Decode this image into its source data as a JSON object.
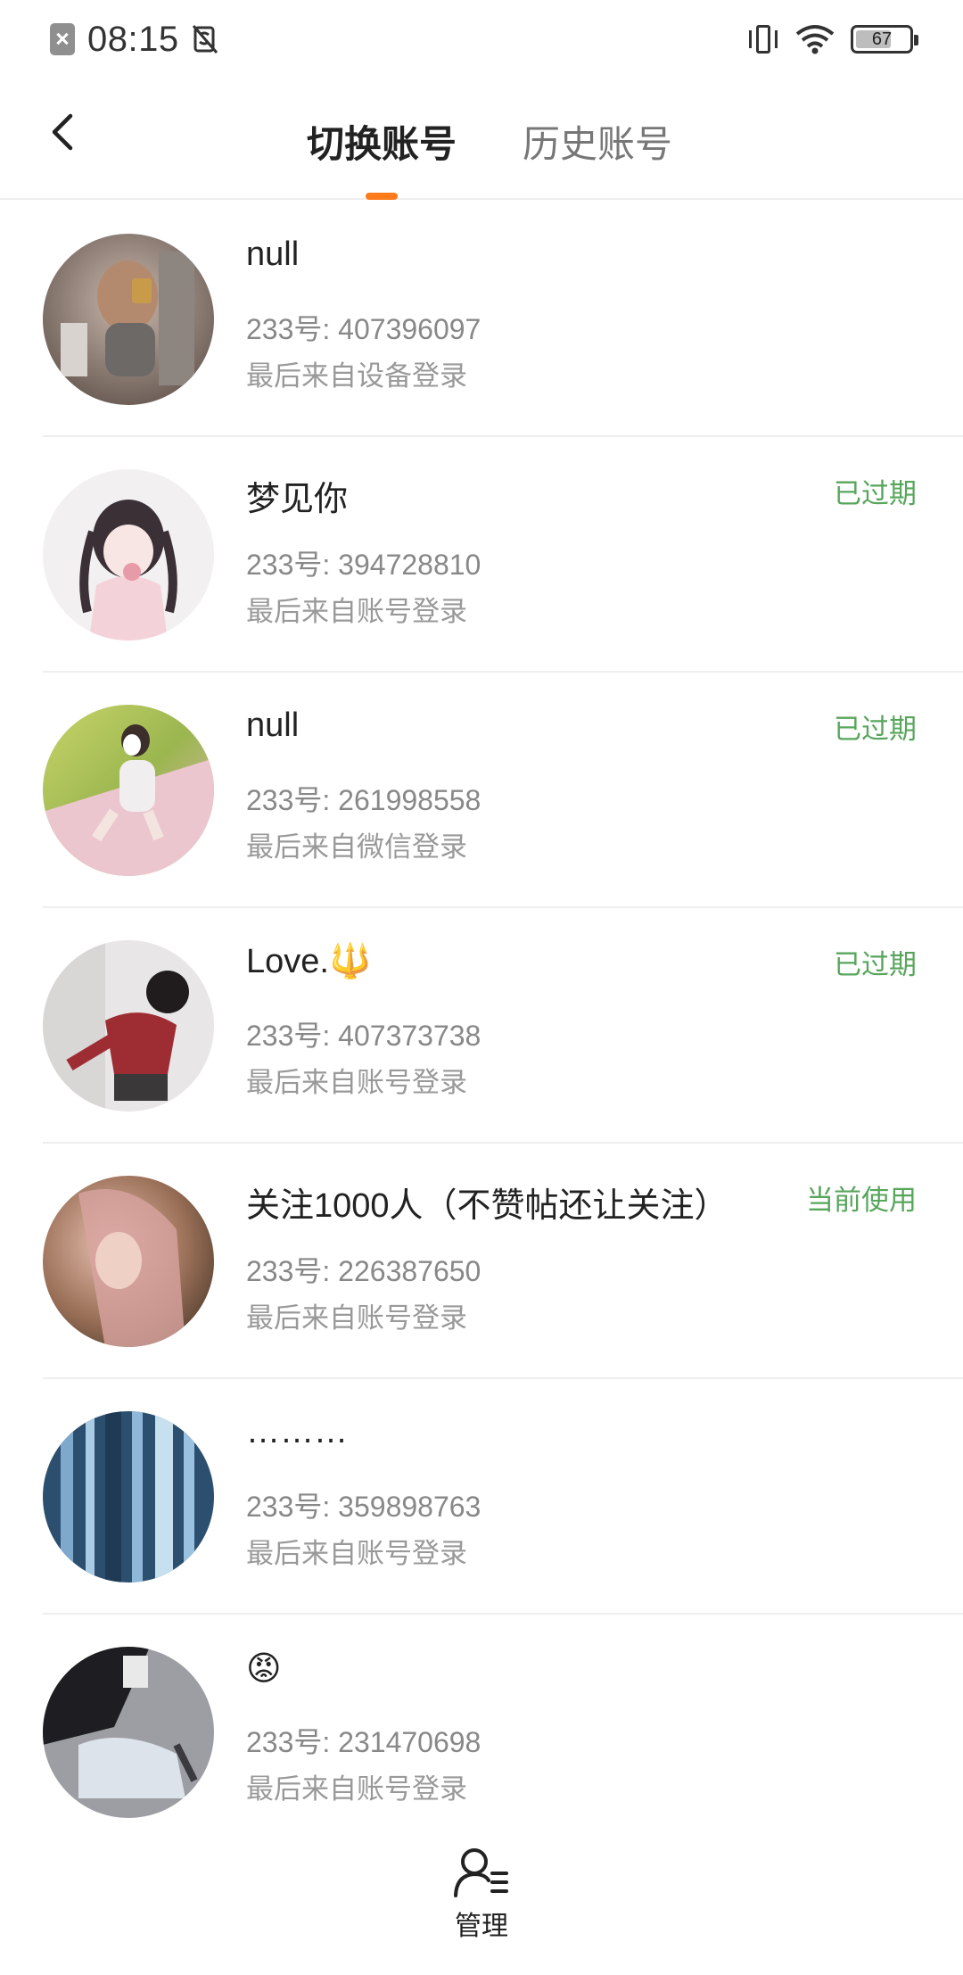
{
  "status_bar": {
    "time": "08:15",
    "battery": "67",
    "battery_level": 0.67
  },
  "header": {
    "tabs": [
      {
        "label": "切换账号",
        "active": true
      },
      {
        "label": "历史账号",
        "active": false
      }
    ],
    "accent_color": "#ff7a1a"
  },
  "accounts": [
    {
      "name": "null",
      "uid": "233号: 407396097",
      "login_source": "最后来自设备登录",
      "status": ""
    },
    {
      "name": "梦见你",
      "uid": "233号: 394728810",
      "login_source": "最后来自账号登录",
      "status": "已过期"
    },
    {
      "name": "null",
      "uid": "233号: 261998558",
      "login_source": "最后来自微信登录",
      "status": "已过期"
    },
    {
      "name": "Love.🔱",
      "uid": "233号: 407373738",
      "login_source": "最后来自账号登录",
      "status": "已过期"
    },
    {
      "name": "关注1000人（不赞帖还让关注）",
      "uid": "233号: 226387650",
      "login_source": "最后来自账号登录",
      "status": "当前使用"
    },
    {
      "name": "………",
      "uid": "233号: 359898763",
      "login_source": "最后来自账号登录",
      "status": ""
    },
    {
      "name": "😡",
      "uid": "233号: 231470698",
      "login_source": "最后来自账号登录",
      "status": ""
    }
  ],
  "status_color": "#58a65c",
  "bottom": {
    "manage_label": "管理",
    "manage_icon": "user-list-icon"
  }
}
